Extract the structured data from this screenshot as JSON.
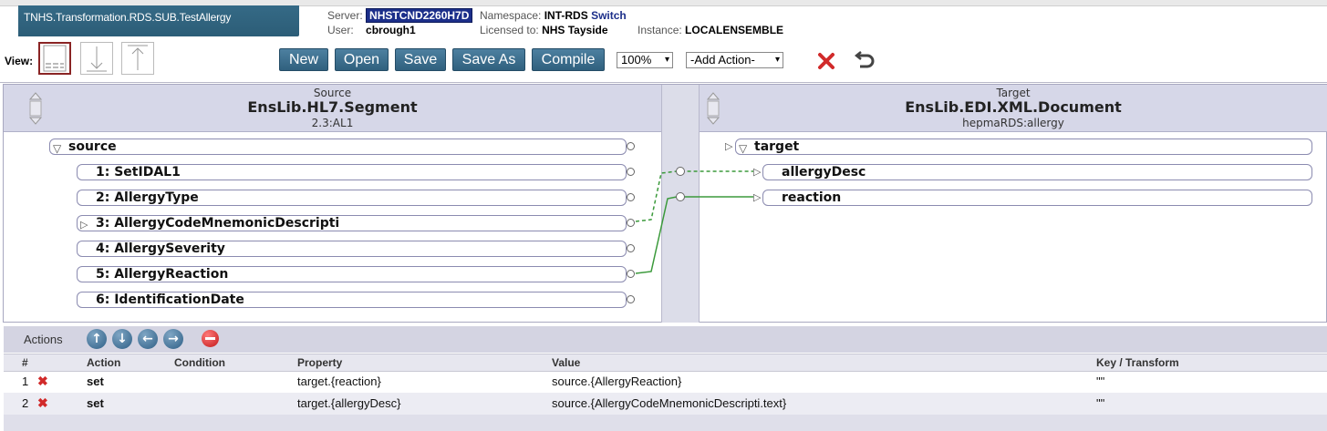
{
  "header": {
    "title": "TNHS.Transformation.RDS.SUB.TestAllergy",
    "server_label": "Server:",
    "server_value": "NHSTCND2260H7D",
    "namespace_label": "Namespace:",
    "namespace_value": "INT-RDS",
    "switch_label": "Switch",
    "user_label": "User:",
    "user_value": "cbrough1",
    "licensed_label": "Licensed to:",
    "licensed_value": "NHS Tayside",
    "instance_label": "Instance:",
    "instance_value": "LOCALENSEMBLE"
  },
  "toolbar": {
    "view_label": "View:",
    "view_icons": [
      "split-view-icon",
      "source-view-icon",
      "target-view-icon"
    ],
    "buttons": {
      "new": "New",
      "open": "Open",
      "save": "Save",
      "save_as": "Save As",
      "compile": "Compile"
    },
    "zoom_value": "100%",
    "add_action_value": "-Add Action-",
    "icons": [
      "close-icon",
      "undo-icon"
    ]
  },
  "source": {
    "small_label": "Source",
    "class_name": "EnsLib.HL7.Segment",
    "doc_type": "2.3:AL1",
    "root": "source",
    "fields": [
      "1: SetIDAL1",
      "2: AllergyType",
      "3: AllergyCodeMnemonicDescripti",
      "4: AllergySeverity",
      "5: AllergyReaction",
      "6: IdentificationDate"
    ]
  },
  "target": {
    "small_label": "Target",
    "class_name": "EnsLib.EDI.XML.Document",
    "doc_type": "hepmaRDS:allergy",
    "root": "target",
    "fields": [
      "allergyDesc",
      "reaction"
    ]
  },
  "actions": {
    "title": "Actions",
    "icons": [
      "move-up-icon",
      "move-down-icon",
      "indent-left-icon",
      "indent-right-icon",
      "delete-icon"
    ],
    "columns": {
      "num": "#",
      "action": "Action",
      "condition": "Condition",
      "property": "Property",
      "value": "Value",
      "key": "Key / Transform"
    },
    "rows": [
      {
        "num": "1",
        "action": "set",
        "condition": "",
        "property": "target.{reaction}",
        "value": "source.{AllergyReaction}",
        "key": "\"\""
      },
      {
        "num": "2",
        "action": "set",
        "condition": "",
        "property": "target.{allergyDesc}",
        "value": "source.{AllergyCodeMnemonicDescripti.text}",
        "key": "\"\""
      }
    ]
  },
  "colors": {
    "brand": "#2c5d77",
    "button": "#3f7192",
    "connector": "#3b9a3b",
    "header_band": "#d6d7e8",
    "delete": "#d12a2a"
  }
}
